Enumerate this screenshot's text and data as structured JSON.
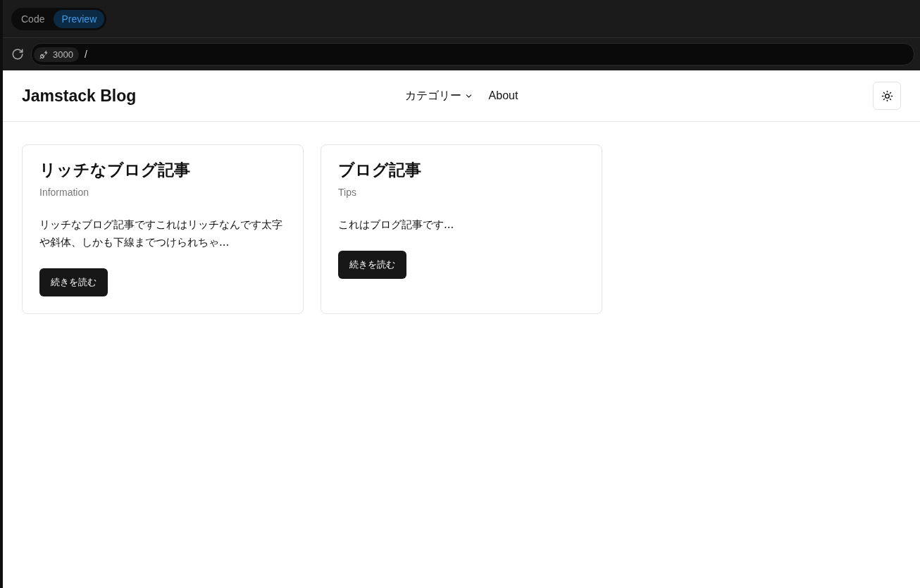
{
  "toolbar": {
    "tabs": [
      {
        "label": "Code",
        "selected": false
      },
      {
        "label": "Preview",
        "selected": true
      }
    ]
  },
  "address_bar": {
    "port": "3000",
    "path": "/"
  },
  "site": {
    "title": "Jamstack Blog",
    "nav": [
      {
        "label": "カテゴリー",
        "kind": "dropdown"
      },
      {
        "label": "About",
        "kind": "link"
      }
    ]
  },
  "posts": [
    {
      "title": "リッチなブログ記事",
      "category": "Information",
      "excerpt": "リッチなブログ記事ですこれはリッチなんです太字や斜体、しかも下線までつけられちゃ...",
      "button": "続きを読む"
    },
    {
      "title": "ブログ記事",
      "category": "Tips",
      "excerpt": "これはブログ記事です...",
      "button": "続きを読む"
    }
  ]
}
